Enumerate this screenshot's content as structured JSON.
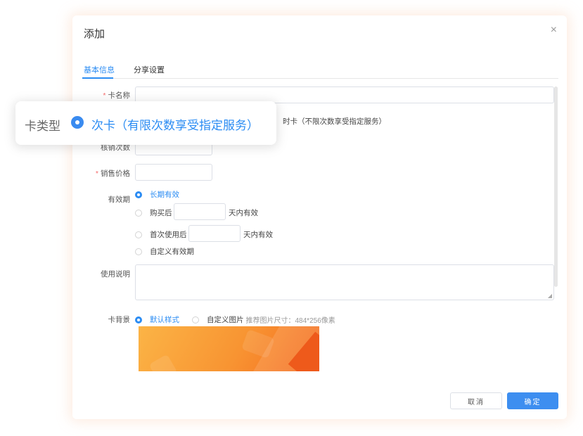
{
  "dialog": {
    "title": "添加",
    "close_glyph": "×",
    "tabs": [
      {
        "label": "基本信息",
        "active": true
      },
      {
        "label": "分享设置",
        "active": false
      }
    ]
  },
  "form": {
    "card_name": {
      "label": "卡名称",
      "required_mark": "*",
      "value": ""
    },
    "card_type": {
      "label": "卡类型",
      "options": [
        {
          "label": "次卡（有限次数享受指定服务）",
          "selected": true
        },
        {
          "label": "时卡（不限次数享受指定服务）",
          "selected": false
        }
      ]
    },
    "redeem_count": {
      "label": "核销次数",
      "value": ""
    },
    "price": {
      "label": "销售价格",
      "required_mark": "*",
      "value": ""
    },
    "validity": {
      "label": "有效期",
      "options": [
        {
          "label": "长期有效",
          "selected": true
        },
        {
          "label": "购买后",
          "suffix": "天内有效",
          "selected": false
        },
        {
          "label": "首次使用后",
          "suffix": "天内有效",
          "selected": false
        },
        {
          "label": "自定义有效期",
          "selected": false
        }
      ]
    },
    "instructions": {
      "label": "使用说明",
      "value": ""
    },
    "background": {
      "label": "卡背景",
      "options": [
        {
          "label": "默认样式",
          "selected": true
        },
        {
          "label": "自定义图片",
          "selected": false
        }
      ],
      "hint": "推荐图片尺寸：484*256像素"
    }
  },
  "footer": {
    "cancel_label": "取消",
    "ok_label": "确定"
  },
  "colors": {
    "accent": "#2b8cf3",
    "required": "#f56c6c",
    "card_gradient_start": "#fbb446",
    "card_gradient_end": "#f46a1f"
  }
}
